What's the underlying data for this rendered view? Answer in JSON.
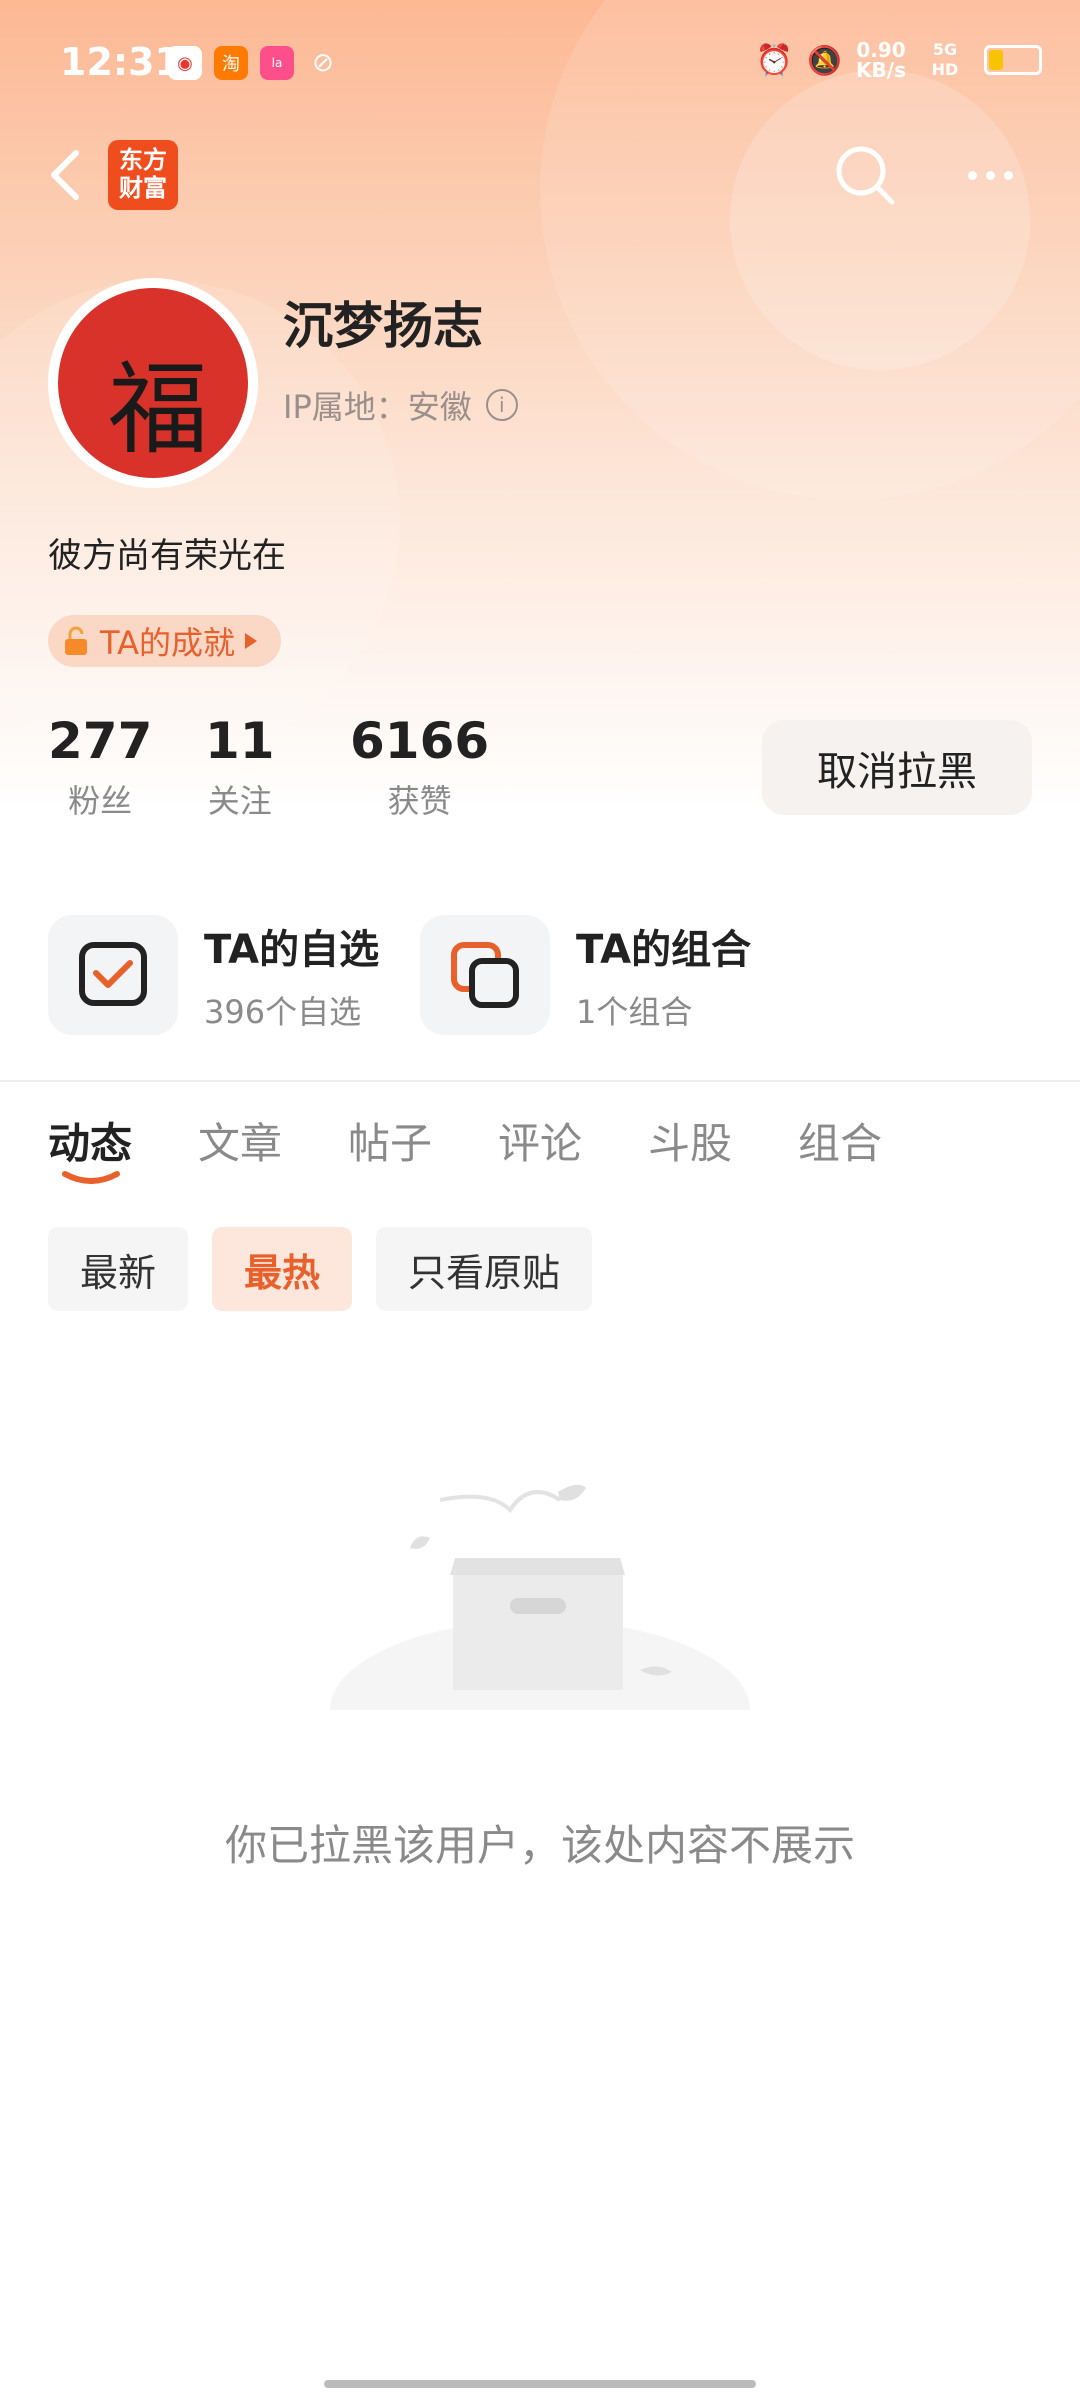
{
  "status_bar": {
    "time": "12:31",
    "net_speed_value": "0.90",
    "net_speed_unit": "KB/s",
    "signal": "5G HD"
  },
  "header": {
    "brand_line1": "东方",
    "brand_line2": "财富"
  },
  "profile": {
    "username": "沉梦扬志",
    "ip_label": "IP属地：安徽",
    "bio": "彼方尚有荣光在",
    "achievement_label": "TA的成就",
    "avatar_glyph": "福",
    "stats": [
      {
        "value": "277",
        "label": "粉丝"
      },
      {
        "value": "11",
        "label": "关注"
      },
      {
        "value": "6166",
        "label": "获赞"
      }
    ],
    "unblock_label": "取消拉黑"
  },
  "shortcuts": [
    {
      "title": "TA的自选",
      "subtitle": "396个自选",
      "icon": "checkbox-icon"
    },
    {
      "title": "TA的组合",
      "subtitle": "1个组合",
      "icon": "overlap-squares-icon"
    }
  ],
  "tabs": [
    {
      "label": "动态",
      "active": true
    },
    {
      "label": "文章"
    },
    {
      "label": "帖子"
    },
    {
      "label": "评论"
    },
    {
      "label": "斗股"
    },
    {
      "label": "组合"
    }
  ],
  "filters": [
    {
      "label": "最新"
    },
    {
      "label": "最热",
      "active": true
    },
    {
      "label": "只看原贴"
    }
  ],
  "empty_state": {
    "message": "你已拉黑该用户，该处内容不展示"
  },
  "colors": {
    "accent": "#e8612c",
    "brand_logo": "#f04d1f"
  }
}
